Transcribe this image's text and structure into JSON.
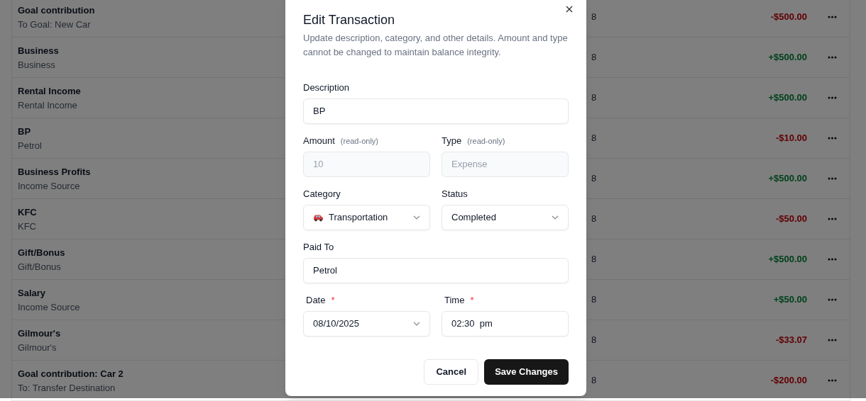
{
  "transactions": [
    {
      "title": "Goal contribution",
      "subtitle": "To Goal: New Car",
      "date": "8",
      "amount": "-$500.00",
      "kind": "expense"
    },
    {
      "title": "Business",
      "subtitle": "Business",
      "date": "8",
      "amount": "+$500.00",
      "kind": "income"
    },
    {
      "title": "Rental Income",
      "subtitle": "Rental Income",
      "date": "8",
      "amount": "+$500.00",
      "kind": "income"
    },
    {
      "title": "BP",
      "subtitle": "Petrol",
      "date": "8",
      "amount": "-$10.00",
      "kind": "expense"
    },
    {
      "title": "Business Profits",
      "subtitle": "Income Source",
      "date": "8",
      "amount": "+$500.00",
      "kind": "income"
    },
    {
      "title": "KFC",
      "subtitle": "KFC",
      "date": "8",
      "amount": "-$50.00",
      "kind": "expense"
    },
    {
      "title": "Gift/Bonus",
      "subtitle": "Gift/Bonus",
      "date": "8",
      "amount": "+$500.00",
      "kind": "income"
    },
    {
      "title": "Salary",
      "subtitle": "Income Source",
      "date": "8",
      "amount": "+$50.00",
      "kind": "income"
    },
    {
      "title": "Gilmour's",
      "subtitle": "Gilmour's",
      "date": "8",
      "amount": "-$33.07",
      "kind": "expense"
    },
    {
      "title": "Goal contribution: Car 2",
      "subtitle": "To: Transfer Destination",
      "date": "8",
      "amount": "-$200.00",
      "kind": "expense"
    }
  ],
  "dialog": {
    "title": "Edit Transaction",
    "description": "Update description, category, and other details. Amount and type cannot be changed to maintain balance integrity.",
    "rows": [
      [
        {
          "label": "Description",
          "kind": "text",
          "value": "BP"
        }
      ],
      [
        {
          "label": "Amount",
          "hint": "(read-only)",
          "kind": "readonly",
          "value": "10"
        },
        {
          "label": "Type",
          "hint": "(read-only)",
          "kind": "readonly",
          "value": "Expense"
        }
      ],
      [
        {
          "label": "Category",
          "kind": "category",
          "value": "Transportation"
        },
        {
          "label": "Status",
          "kind": "select",
          "value": "Completed"
        }
      ],
      [
        {
          "label": "Paid To",
          "kind": "text",
          "value": "Petrol"
        }
      ],
      [
        {
          "label": "Date",
          "required_mark": "*",
          "kind": "select",
          "value": "08/10/2025"
        },
        {
          "label": "Time",
          "required_mark": "*",
          "kind": "text",
          "value": "02:30  pm"
        }
      ]
    ],
    "buttons": [
      {
        "label": "Cancel",
        "kind": "secondary"
      },
      {
        "label": "Save Changes",
        "kind": "primary"
      }
    ]
  }
}
